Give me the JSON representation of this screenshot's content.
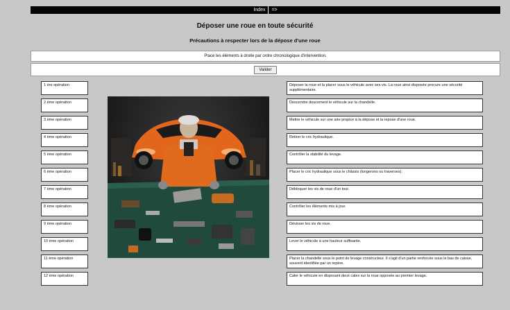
{
  "nav": {
    "index_label": "Index",
    "next_label": "=>"
  },
  "page": {
    "title": "Déposer une roue en toute sécurité",
    "subtitle": "Précautions à respecter lors de la dépose d'une roue",
    "instruction": "Place les éléments à droite par ordre chronologique d'intervention.",
    "validate_label": "Valider"
  },
  "operations": [
    "1 ère opération",
    "2 ème opération",
    "3 ème opération",
    "4 ème opération",
    "5 ème opération",
    "6 ème opération",
    "7 ème opération",
    "8 ème opération",
    "9 ème opération",
    "10 ème opération",
    "11 ème opération",
    "12 ème opération"
  ],
  "answers": [
    "Déposer la roue et la placer sous le véhicule avec ses vis. La roue ainsi disposée procure une sécurité supplémentaire.",
    "Descendre doucement le véhicule sur la chandelle.",
    "Mettre le véhicule sur une aire propice à la dépose et la repose d'une roue.",
    "Retirer le cric hydraulique.",
    "Contrôler la stabilité du levage.",
    "Placer le cric hydraulique sous le châssis (longerons ou traverses).",
    "Débloquer les vis de roue d'un tour.",
    "Contrôler les éléments mis à jour.",
    "Dévisser les vis de roue.",
    "Lever le véhicule à une hauteur suffisante.",
    "Placer la chandelle sous le point de levage constructeur. Il s'agit d'un partie renforcée sous le bas de caisse, souvent identifiée par un repère.",
    "Caler le véhicule en disposant deux cales sur la roue opposée au premier levage."
  ]
}
